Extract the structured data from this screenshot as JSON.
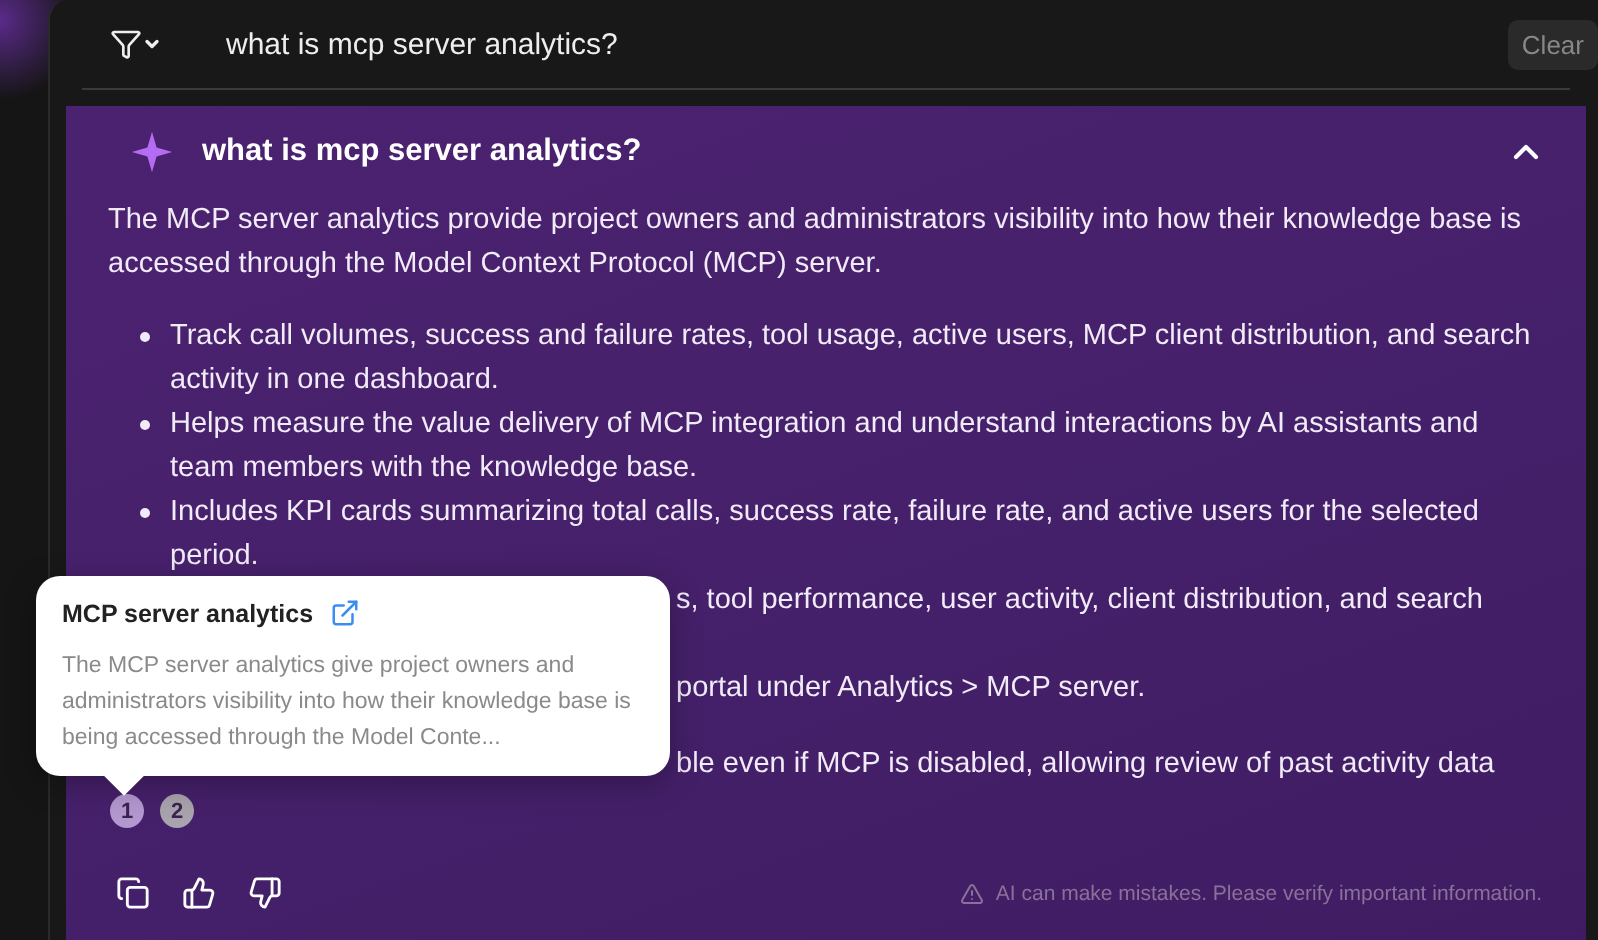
{
  "search": {
    "value": "what is mcp server analytics?",
    "clear_label": "Clear"
  },
  "answer": {
    "title": "what is mcp server analytics?",
    "expanded": true,
    "intro": "The MCP server analytics provide project owners and administrators visibility into how their knowledge base is accessed through the Model Context Protocol (MCP) server.",
    "bullets": [
      {
        "kind": "full",
        "text": "Track call volumes, success and failure rates, tool usage, active users, MCP client distribution, and search activity in one dashboard."
      },
      {
        "kind": "full",
        "text": "Helps measure the value delivery of MCP integration and understand interactions by AI assistants and team members with the knowledge base."
      },
      {
        "kind": "full",
        "text": "Includes KPI cards summarizing total calls, success rate, failure rate, and active users for the selected period."
      },
      {
        "kind": "covered",
        "text": "s, tool performance, user activity, client distribution, and search"
      },
      {
        "kind": "covered",
        "text": "portal under Analytics > MCP server."
      },
      {
        "kind": "covered",
        "text": "ble even if MCP is disabled, allowing review of past activity data"
      }
    ],
    "citations": [
      {
        "label": "1",
        "selected": true
      },
      {
        "label": "2",
        "selected": false
      }
    ],
    "disclaimer": "AI can make mistakes. Please verify important information."
  },
  "tooltip": {
    "title": "MCP server analytics",
    "body": "The MCP server analytics give project owners and administrators visibility into how their knowledge base is being accessed through the Model Conte..."
  }
}
